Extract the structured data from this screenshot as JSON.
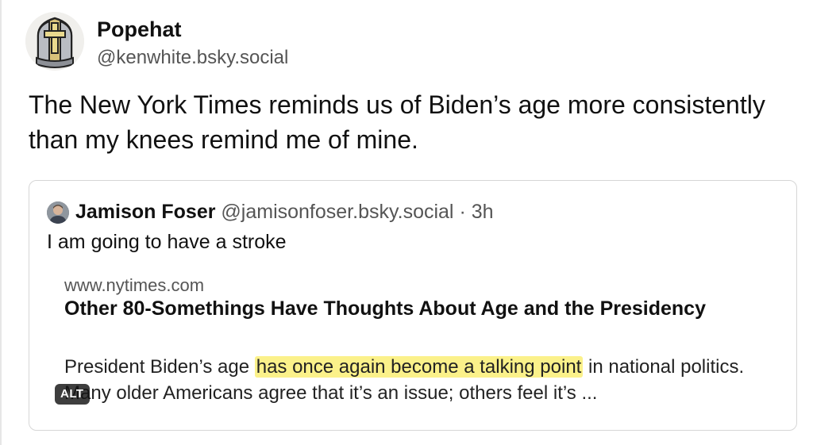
{
  "post": {
    "author_name": "Popehat",
    "author_handle": "@kenwhite.bsky.social",
    "avatar_icon": "bishop-mitre-avatar-icon",
    "text": "The New York Times reminds us of Biden’s age more consistently than my knees remind me of mine."
  },
  "quote": {
    "author_name": "Jamison Foser",
    "author_handle": "@jamisonfoser.bsky.social",
    "separator": " · ",
    "time": "3h",
    "avatar_icon": "person-photo-avatar-icon",
    "text": "I am going to have a stroke",
    "link": {
      "domain": "www.nytimes.com",
      "title": "Other 80-Somethings Have Thoughts About Age and the Presidency",
      "desc_before": "President Biden’s age ",
      "desc_highlight": "has once again become a talking point",
      "desc_after": " in national politics. Many older Americans agree that it’s an issue; others feel it’s ...",
      "alt_badge": "ALT"
    }
  },
  "colors": {
    "highlight": "#fbf18a",
    "text_primary": "#111111",
    "text_secondary": "#555555",
    "card_border": "#d6d6d6"
  }
}
